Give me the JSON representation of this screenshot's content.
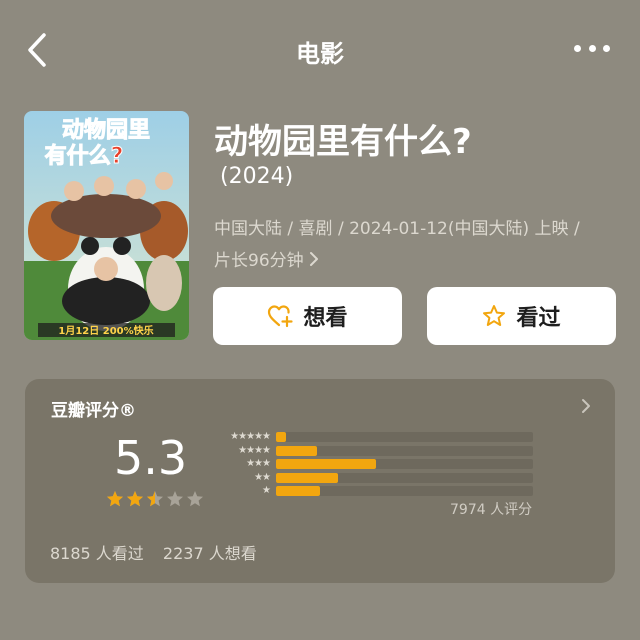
{
  "nav": {
    "title": "电影",
    "back_icon": "chevron-left-icon",
    "more_icon": "more-dots-icon"
  },
  "movie": {
    "title": "动物园里有什么?",
    "year": "(2024)",
    "meta_line1": "中国大陆 / 喜剧 / 2024-01-12(中国大陆) 上映 /",
    "meta_line2": "片长96分钟",
    "poster": {
      "title_art": "动物园里有什么?",
      "release_banner": "1月12日 200%快乐"
    }
  },
  "actions": {
    "want_label": "想看",
    "seen_label": "看过",
    "want_icon": "heart-plus-icon",
    "seen_icon": "star-outline-icon"
  },
  "rating": {
    "title": "豆瓣评分®",
    "score": "5.3",
    "score_value": 5.3,
    "star_fill": 2.5,
    "distribution": [
      {
        "label": "★★★★★",
        "fraction": 0.04
      },
      {
        "label": "★★★★",
        "fraction": 0.16
      },
      {
        "label": "★★★",
        "fraction": 0.39
      },
      {
        "label": "★★",
        "fraction": 0.24
      },
      {
        "label": "★",
        "fraction": 0.17
      }
    ],
    "total_count": "7974 人评分",
    "seen_count": "8185 人看过",
    "want_count": "2237 人想看"
  },
  "colors": {
    "background": "#8e8a7f",
    "card": "#7a7568",
    "accent": "#f2a60f"
  }
}
